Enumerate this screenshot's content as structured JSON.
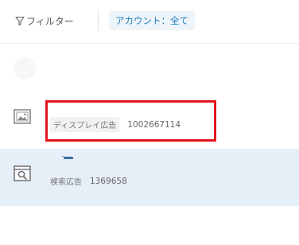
{
  "filter": {
    "label": "フィルター",
    "chip_label": "アカウント：全て"
  },
  "rows": [
    {
      "type_label": "ディスプレイ広告",
      "id": "1002667114",
      "icon": "display-ad-image-icon"
    },
    {
      "type_label": "検索広告",
      "id": "1369658",
      "icon": "search-ad-icon"
    }
  ],
  "colors": {
    "accent": "#1e7fc0",
    "selected_row": "#e6eef8",
    "highlight": "#e5141d"
  }
}
